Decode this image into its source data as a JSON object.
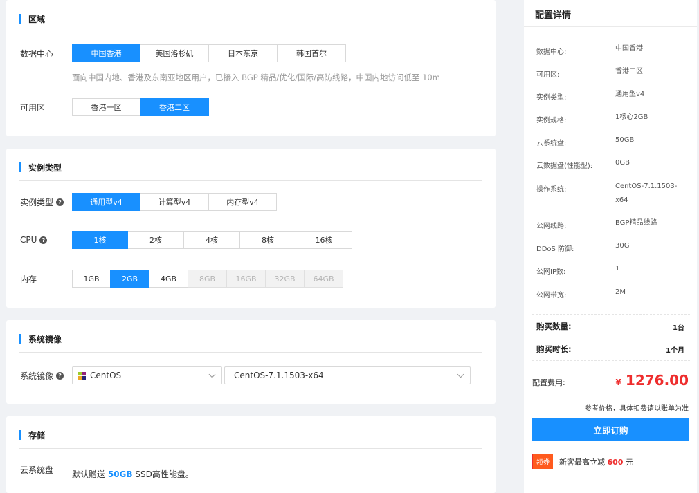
{
  "region_section": {
    "title": "区域",
    "datacenter_label": "数据中心",
    "datacenters": [
      "中国香港",
      "美国洛杉矶",
      "日本东京",
      "韩国首尔"
    ],
    "datacenter_selected": 0,
    "hint": "面向中国内地、香港及东南亚地区用户，已接入 BGP 精品/优化/国际/高防线路，中国内地访问低至 10m",
    "zone_label": "可用区",
    "zones": [
      "香港一区",
      "香港二区"
    ],
    "zone_selected": 1
  },
  "instance_section": {
    "title": "实例类型",
    "type_label": "实例类型",
    "types": [
      "通用型v4",
      "计算型v4",
      "内存型v4"
    ],
    "type_selected": 0,
    "cpu_label": "CPU",
    "cpus": [
      "1核",
      "2核",
      "4核",
      "8核",
      "16核"
    ],
    "cpu_selected": 0,
    "mem_label": "内存",
    "mems": [
      "1GB",
      "2GB",
      "4GB",
      "8GB",
      "16GB",
      "32GB",
      "64GB"
    ],
    "mem_selected": 1,
    "mem_disabled_from": 3
  },
  "image_section": {
    "title": "系统镜像",
    "label": "系统镜像",
    "os": "CentOS",
    "version": "CentOS-7.1.1503-x64"
  },
  "storage_section": {
    "title": "存储",
    "label": "云系统盘",
    "text_before": "默认赠送",
    "amount": "50GB",
    "text_after": "SSD高性能盘。"
  },
  "summary": {
    "title": "配置详情",
    "specs": [
      {
        "label": "数据中心:",
        "value": "中国香港"
      },
      {
        "label": "可用区:",
        "value": "香港二区"
      },
      {
        "label": "实例类型:",
        "value": "通用型v4"
      },
      {
        "label": "实例规格:",
        "value": "1核心2GB"
      },
      {
        "label": "云系统盘:",
        "value": "50GB"
      },
      {
        "label": "云数据盘(性能型):",
        "value": "0GB"
      },
      {
        "label": "操作系统:",
        "value": "CentOS-7.1.1503-x64"
      },
      {
        "label": "公网线路:",
        "value": "BGP精品线路"
      },
      {
        "label": "DDoS 防御:",
        "value": "30G"
      },
      {
        "label": "公网IP数:",
        "value": "1"
      },
      {
        "label": "公网带宽:",
        "value": "2M"
      }
    ],
    "qty_label": "购买数量:",
    "qty_value": "1台",
    "duration_label": "购买时长:",
    "duration_value": "1个月",
    "fee_label": "配置费用:",
    "currency": "¥",
    "price": "1276.00",
    "ref_note": "参考价格，具体扣费请以账单为准",
    "order_button": "立即订购",
    "coupon_tag": "领券",
    "coupon_text": "新客最高立减",
    "coupon_amount": "600",
    "coupon_unit": "元"
  },
  "colors": {
    "accent": "#1890ff",
    "price": "#ee2d2d",
    "coupon_tag": "#ff5a1e"
  }
}
